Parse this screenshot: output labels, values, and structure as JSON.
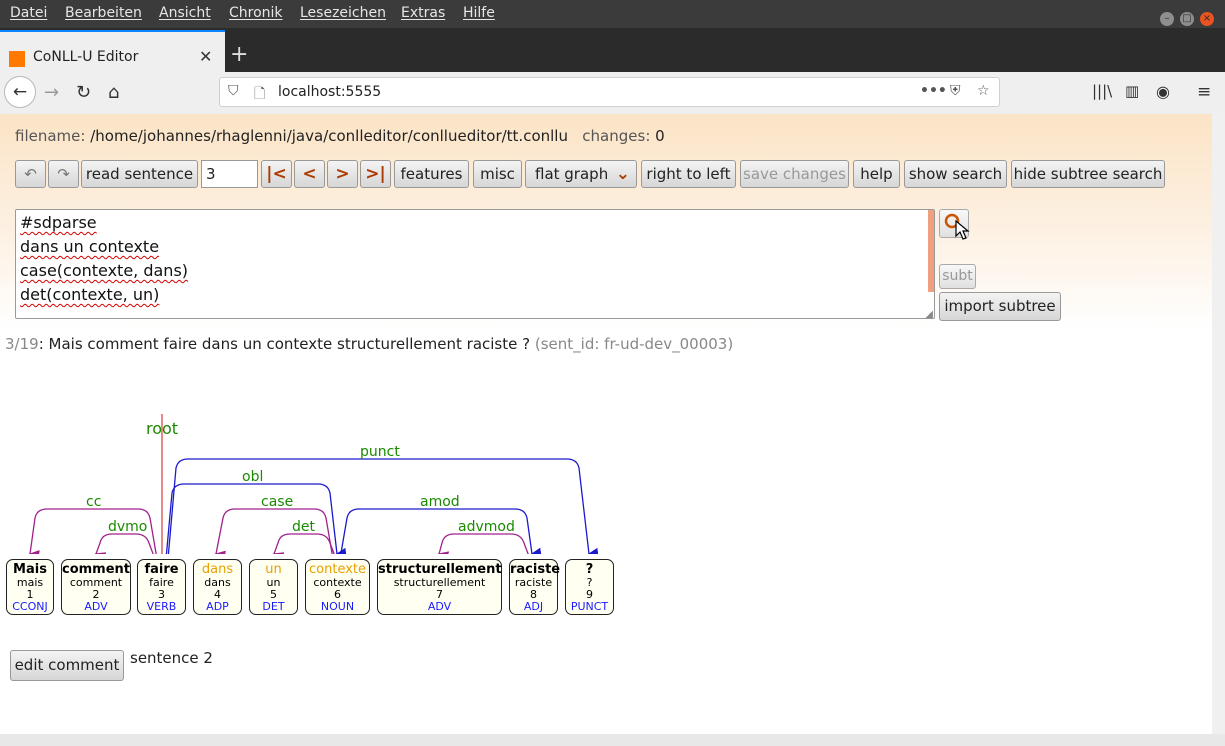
{
  "menubar": {
    "items": [
      "Datei",
      "Bearbeiten",
      "Ansicht",
      "Chronik",
      "Lesezeichen",
      "Extras",
      "Hilfe"
    ]
  },
  "browser": {
    "tab_title": "CoNLL-U Editor",
    "url": "localhost:5555"
  },
  "header": {
    "filename_label": "filename:",
    "filename": "/home/johannes/rhaglenni/java/conlleditor/conllueditor/tt.conllu",
    "changes_label": "changes:",
    "changes": "0"
  },
  "toolbar": {
    "read_sentence": "read sentence",
    "sentence_number": "3",
    "features": "features",
    "misc": "misc",
    "graph_mode": "flat graph",
    "right_to_left": "right to left",
    "save_changes": "save changes",
    "help": "help",
    "show_search": "show search",
    "hide_subtree_search": "hide subtree search"
  },
  "editor": {
    "lines": [
      "#sdparse",
      "dans un contexte",
      "case(contexte, dans)",
      "det(contexte, un)"
    ]
  },
  "subtree": {
    "subt_label": "subt",
    "import_label": "import subtree"
  },
  "sentence": {
    "counter": "3/19",
    "text": "Mais comment faire dans un contexte structurellement raciste ?",
    "sent_id": "(sent_id: fr-ud-dev_00003)"
  },
  "graph": {
    "root_label": "root",
    "tokens": [
      {
        "form": "Mais",
        "lemma": "mais",
        "id": "1",
        "upos": "CCONJ"
      },
      {
        "form": "comment",
        "lemma": "comment",
        "id": "2",
        "upos": "ADV"
      },
      {
        "form": "faire",
        "lemma": "faire",
        "id": "3",
        "upos": "VERB"
      },
      {
        "form": "dans",
        "lemma": "dans",
        "id": "4",
        "upos": "ADP"
      },
      {
        "form": "un",
        "lemma": "un",
        "id": "5",
        "upos": "DET"
      },
      {
        "form": "contexte",
        "lemma": "contexte",
        "id": "6",
        "upos": "NOUN"
      },
      {
        "form": "structurellement",
        "lemma": "structurellement",
        "id": "7",
        "upos": "ADV"
      },
      {
        "form": "raciste",
        "lemma": "raciste",
        "id": "8",
        "upos": "ADJ"
      },
      {
        "form": "?",
        "lemma": "?",
        "id": "9",
        "upos": "PUNCT"
      }
    ],
    "relations": [
      {
        "label": "cc",
        "color": "#a0208c"
      },
      {
        "label": "dvmo",
        "color": "#a0208c"
      },
      {
        "label": "obl",
        "color": "#1a1acc"
      },
      {
        "label": "case",
        "color": "#a0208c"
      },
      {
        "label": "det",
        "color": "#a0208c"
      },
      {
        "label": "punct",
        "color": "#1a1acc"
      },
      {
        "label": "amod",
        "color": "#1a1acc"
      },
      {
        "label": "advmod",
        "color": "#a0208c"
      }
    ]
  },
  "footer": {
    "edit_comment": "edit comment",
    "sentence_note": "sentence 2"
  }
}
